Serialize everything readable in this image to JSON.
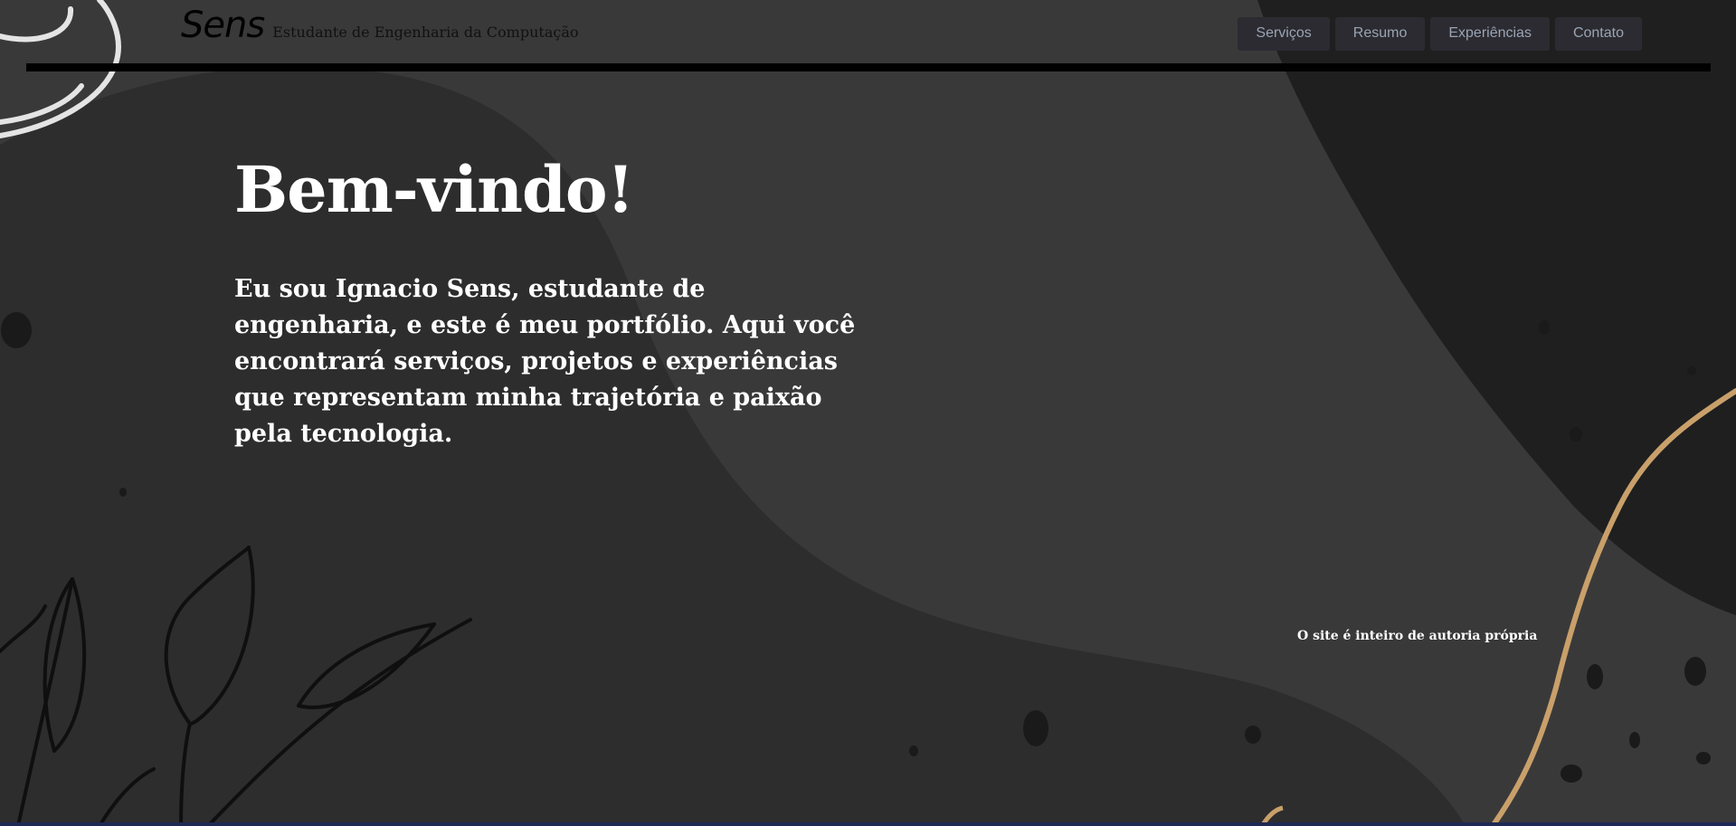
{
  "header": {
    "logo": "Sens",
    "tagline": "Estudante de Engenharia da Computação",
    "nav": [
      {
        "label": "Serviços"
      },
      {
        "label": "Resumo"
      },
      {
        "label": "Experiências"
      },
      {
        "label": "Contato"
      }
    ]
  },
  "hero": {
    "title": "Bem-vindo!",
    "text": "Eu sou Ignacio Sens, estudante de engenharia, e este é meu portfólio. Aqui você encontrará serviços, projetos e experiências que representam minha trajetória e paixão pela tecnologia."
  },
  "footer": {
    "note": "O site é inteiro de autoria própria"
  },
  "colors": {
    "background": "#3a393a",
    "dark_blob": "#2d2d2e",
    "corner_blob": "#1f1f20",
    "gold_line": "#c9a06a",
    "nav_button": "#2b2b31",
    "nav_text": "#9aa4b4"
  }
}
